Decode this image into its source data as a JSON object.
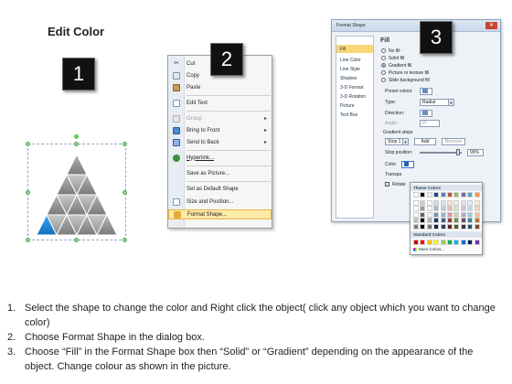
{
  "page": {
    "title": "Edit Color"
  },
  "steps": {
    "one": "1",
    "two": "2",
    "three": "3"
  },
  "context_menu": {
    "items": [
      {
        "label": "Cut",
        "icon": "scissors-icon",
        "enabled": true,
        "submenu": false
      },
      {
        "label": "Copy",
        "icon": "copy-icon",
        "enabled": true,
        "submenu": false
      },
      {
        "label": "Paste",
        "icon": "paste-icon",
        "enabled": true,
        "submenu": false
      },
      {
        "label": "Edit Text",
        "icon": "edit-text-icon",
        "enabled": true,
        "submenu": false
      },
      {
        "label": "Group",
        "icon": "group-icon",
        "enabled": false,
        "submenu": true
      },
      {
        "label": "Bring to Front",
        "icon": "bring-front-icon",
        "enabled": true,
        "submenu": true
      },
      {
        "label": "Send to Back",
        "icon": "send-back-icon",
        "enabled": true,
        "submenu": true
      },
      {
        "label": "Hyperlink...",
        "icon": "hyperlink-icon",
        "enabled": true,
        "submenu": false
      },
      {
        "label": "Save as Picture...",
        "icon": "",
        "enabled": true,
        "submenu": false
      },
      {
        "label": "Set as Default Shape",
        "icon": "",
        "enabled": true,
        "submenu": false
      },
      {
        "label": "Size and Position...",
        "icon": "size-position-icon",
        "enabled": true,
        "submenu": false
      },
      {
        "label": "Format Shape...",
        "icon": "format-shape-icon",
        "enabled": true,
        "submenu": false,
        "highlighted": true
      }
    ]
  },
  "format_dialog": {
    "title": "Format Shape",
    "nav": [
      "Fill",
      "Line Color",
      "Line Style",
      "Shadow",
      "3-D Format",
      "3-D Rotation",
      "Picture",
      "Text Box"
    ],
    "active_nav": "Fill",
    "fill_header": "Fill",
    "fill_options": [
      "No fill",
      "Solid fill",
      "Gradient fill",
      "Picture or texture fill",
      "Slide background fill"
    ],
    "selected_fill": "Gradient fill",
    "preset_colors_label": "Preset colors:",
    "type_label": "Type:",
    "type_value": "Radial",
    "direction_label": "Direction:",
    "angle_label": "Angle:",
    "angle_value": "0°",
    "gradient_stops_label": "Gradient stops",
    "stop_value": "Stop 1",
    "add_label": "Add",
    "remove_label": "Remove",
    "stop_position_label": "Stop position:",
    "stop_position_value": "99%",
    "color_label": "Color:",
    "transparency_label": "Transpa",
    "rotate_label": "Rotate"
  },
  "color_palette": {
    "theme_header": "Theme Colors",
    "standard_header": "Standard Colors",
    "more_colors": "More Colors...",
    "theme_top_row": [
      "#ffffff",
      "#000000",
      "#eeece1",
      "#1f497d",
      "#4f81bd",
      "#c0504d",
      "#9bbb59",
      "#8064a2",
      "#4bacc6",
      "#f79646"
    ],
    "standard_row": [
      "#c00000",
      "#ff0000",
      "#ffc000",
      "#ffff00",
      "#92d050",
      "#00b050",
      "#00b0f0",
      "#0070c0",
      "#002060",
      "#7030a0"
    ]
  },
  "instructions": [
    {
      "num": "1.",
      "text": "Select the shape to change the color and Right click the object( click any object which you want to change color)"
    },
    {
      "num": "2.",
      "text": "Choose Format Shape in the dialog box."
    },
    {
      "num": "3.",
      "text": "Choose “Fill” in the Format Shape box then “Solid” or “Gradient” depending on the appearance of the object. Change colour as shown in the picture."
    }
  ],
  "colors": {
    "triangle_gray": "#8c8c8c",
    "triangle_selected": "#1e88d6",
    "highlight": "#fde9a8",
    "nav_active": "#f9d676"
  }
}
